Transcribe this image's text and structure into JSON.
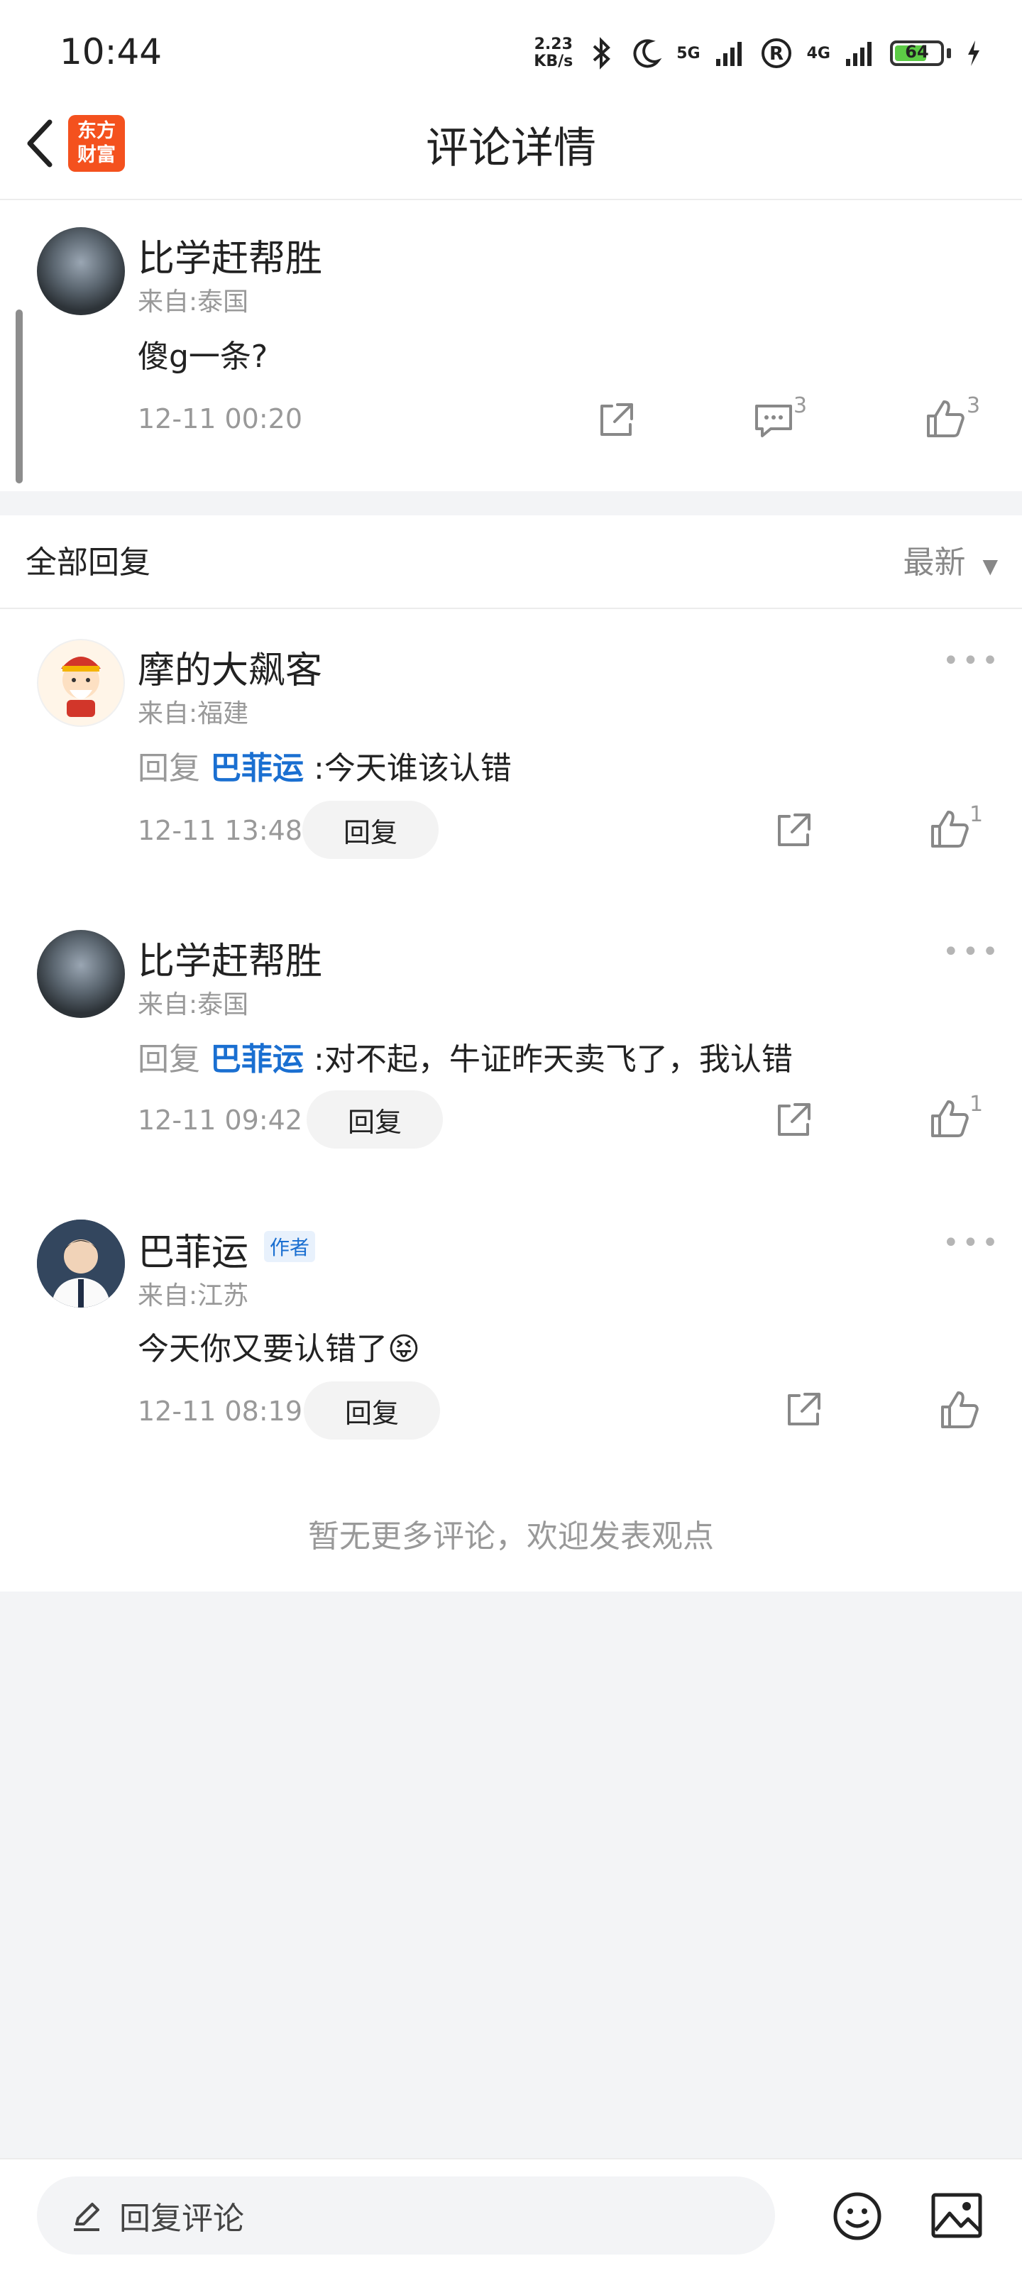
{
  "status_bar": {
    "time": "10:44",
    "speed_value": "2.23",
    "speed_unit": "KB/s",
    "net1": "5G",
    "net2": "4G",
    "battery": "64"
  },
  "header": {
    "logo_line1": "东方",
    "logo_line2": "财富",
    "title": "评论详情"
  },
  "main_comment": {
    "user": "比学赶帮胜",
    "region": "来自:泰国",
    "content": "傻g一条?",
    "time": "12-11 00:20",
    "comment_count": "3",
    "like_count": "3"
  },
  "section": {
    "title": "全部回复",
    "sort": "最新"
  },
  "replies": [
    {
      "user": "摩的大飙客",
      "region": "来自:福建",
      "reply_prefix": "回复",
      "reply_to": "巴菲运",
      "text": ":今天谁该认错",
      "time": "12-11 13:48",
      "reply_label": "回复",
      "like_count": "1"
    },
    {
      "user": "比学赶帮胜",
      "region": "来自:泰国",
      "reply_prefix": "回复",
      "reply_to": "巴菲运",
      "text": ":对不起，牛证昨天卖飞了，我认错",
      "time": "12-11 09:42",
      "reply_label": "回复",
      "like_count": "1"
    },
    {
      "user": "巴菲运",
      "badge": "作者",
      "region": "来自:江苏",
      "text": "今天你又要认错了😝",
      "time": "12-11 08:19",
      "reply_label": "回复"
    }
  ],
  "footer_note": "暂无更多评论，欢迎发表观点",
  "bottom_bar": {
    "placeholder": "回复评论"
  },
  "colors": {
    "accent": "#1a6fd1",
    "logo": "#f4511e",
    "battery": "#5ccb45"
  }
}
